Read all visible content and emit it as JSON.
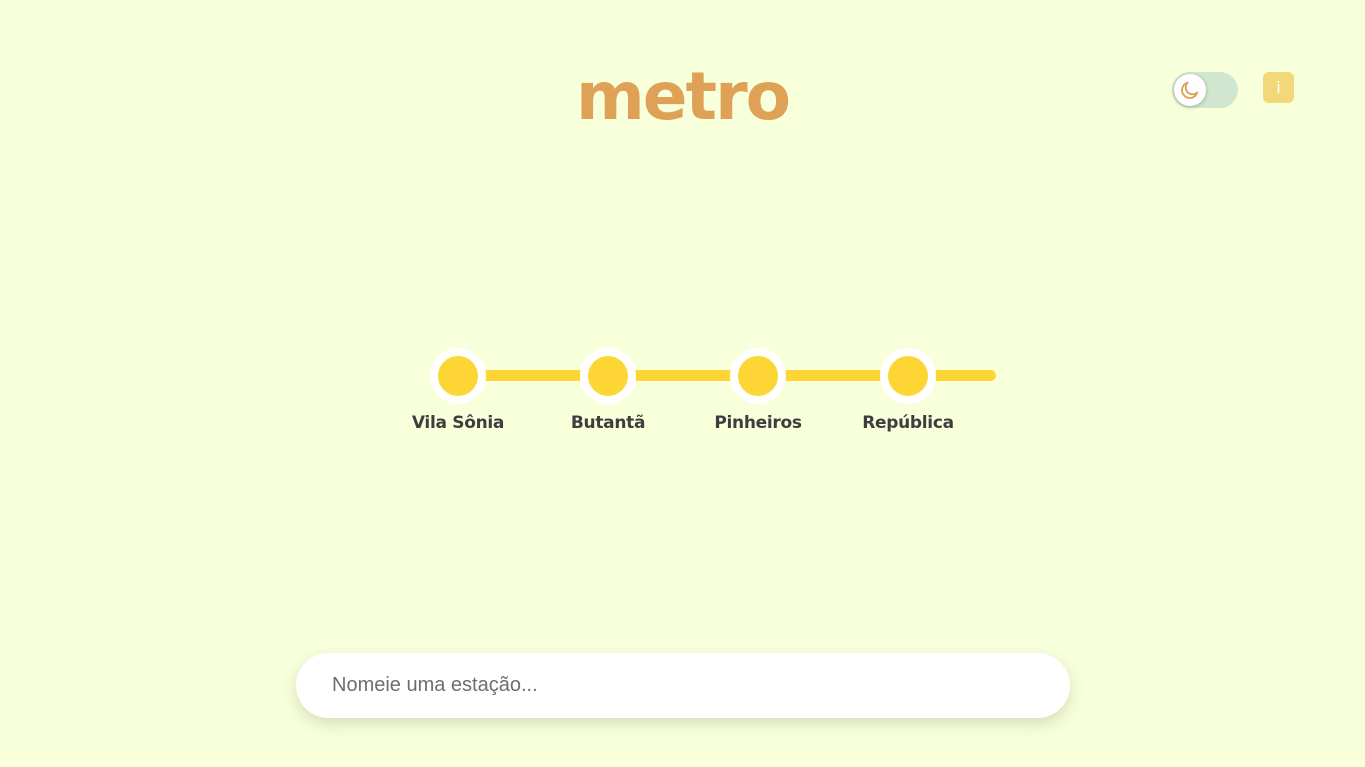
{
  "header": {
    "title": "metro",
    "info_label": "i"
  },
  "controls": {
    "dark_mode_toggle_on": false,
    "toggle_icon": "moon-icon"
  },
  "line": {
    "stations": [
      {
        "name": "Vila Sônia"
      },
      {
        "name": "Butantã"
      },
      {
        "name": "Pinheiros"
      },
      {
        "name": "República"
      }
    ]
  },
  "search": {
    "value": "",
    "placeholder": "Nomeie uma estação..."
  },
  "colors": {
    "background": "#f7ffdb",
    "title": "#dea156",
    "line": "#fdd636",
    "toggle_track": "#d1e6cf",
    "info_button": "#f3d87a",
    "moon_icon": "#dea156"
  }
}
